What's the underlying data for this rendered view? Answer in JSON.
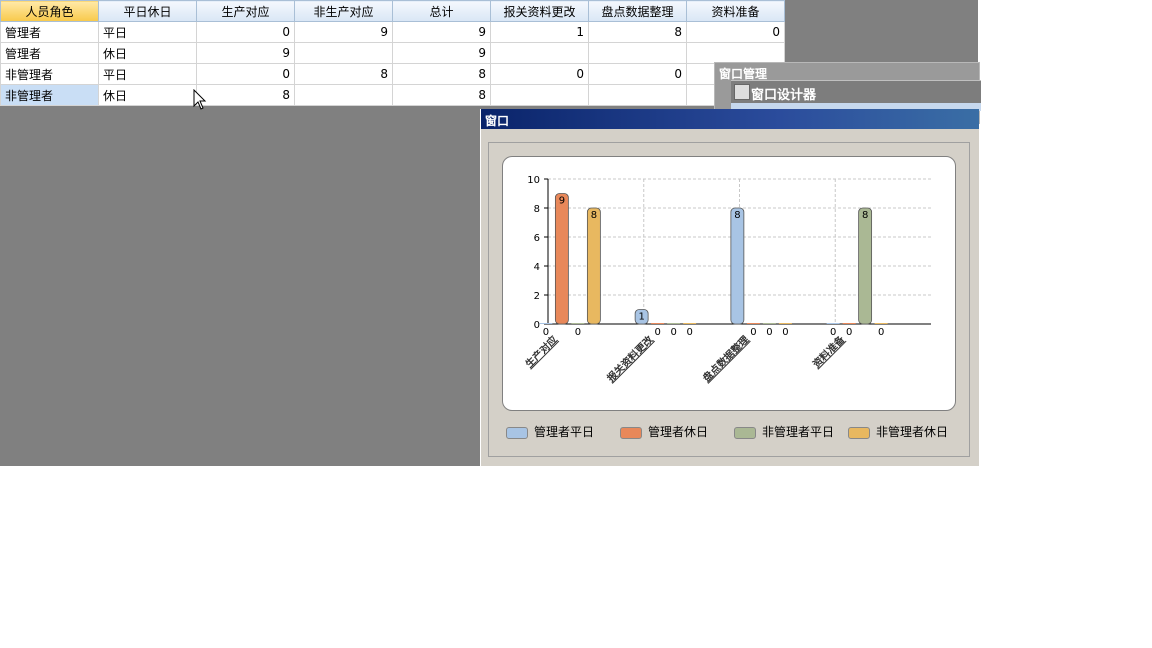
{
  "grid": {
    "headers": [
      "人员角色",
      "平日休日",
      "生产对应",
      "非生产对应",
      "总计",
      "报关资料更改",
      "盘点数据整理",
      "资料准备"
    ],
    "rows": [
      [
        "管理者",
        "平日",
        "0",
        "9",
        "9",
        "1",
        "8",
        "0"
      ],
      [
        "管理者",
        "休日",
        "9",
        "",
        "9",
        "",
        "",
        ""
      ],
      [
        "非管理者",
        "平日",
        "0",
        "8",
        "8",
        "0",
        "0",
        ""
      ],
      [
        "非管理者",
        "休日",
        "8",
        "",
        "8",
        "",
        "",
        ""
      ]
    ]
  },
  "window_manager": {
    "title": "窗口管理",
    "designer_title": "窗口设计器",
    "designer_icon": "designer-icon"
  },
  "chart_window": {
    "title": "窗口"
  },
  "chart_data": {
    "type": "bar",
    "categories": [
      "生产对应",
      "报关资料更改",
      "盘点数据整理",
      "资料准备"
    ],
    "series": [
      {
        "name": "管理者平日",
        "values": [
          0,
          1,
          8,
          0
        ],
        "color": "#a8c4e4"
      },
      {
        "name": "管理者休日",
        "values": [
          9,
          0,
          0,
          0
        ],
        "color": "#e8885a"
      },
      {
        "name": "非管理者平日",
        "values": [
          0,
          0,
          0,
          8
        ],
        "color": "#aab894"
      },
      {
        "name": "非管理者休日",
        "values": [
          8,
          0,
          0,
          0
        ],
        "color": "#e8b860"
      }
    ],
    "ylim": [
      0,
      10
    ],
    "yticks": [
      0,
      2,
      4,
      6,
      8,
      10
    ],
    "grid": true,
    "legend": "bottom"
  }
}
